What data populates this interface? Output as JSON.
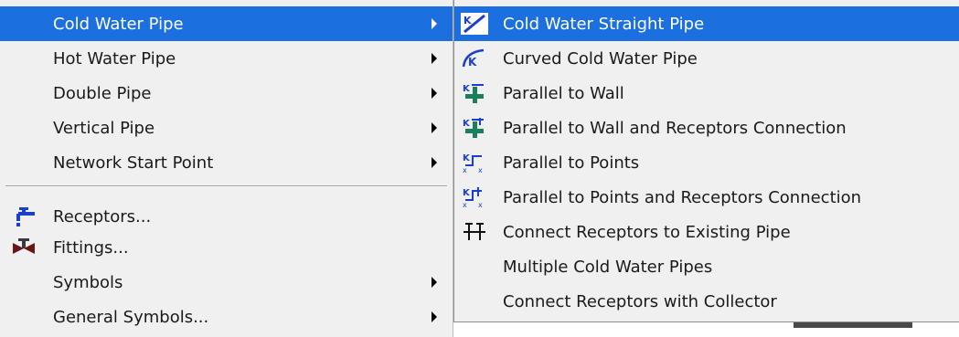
{
  "main_menu": {
    "items": [
      {
        "label": "Cold Water Pipe"
      },
      {
        "label": "Hot Water Pipe"
      },
      {
        "label": "Double Pipe"
      },
      {
        "label": "Vertical Pipe"
      },
      {
        "label": "Network Start Point"
      },
      {
        "label": "Receptors..."
      },
      {
        "label": "Fittings..."
      },
      {
        "label": "Symbols"
      },
      {
        "label": "General Symbols..."
      }
    ]
  },
  "submenu": {
    "items": [
      {
        "label": "Cold Water Straight Pipe"
      },
      {
        "label": "Curved Cold Water Pipe"
      },
      {
        "label": "Parallel to Wall"
      },
      {
        "label": "Parallel to Wall and Receptors Connection"
      },
      {
        "label": "Parallel to Points"
      },
      {
        "label": "Parallel to Points and Receptors Connection"
      },
      {
        "label": "Connect Receptors to Existing Pipe"
      },
      {
        "label": "Multiple Cold Water Pipes"
      },
      {
        "label": "Connect Receptors with Collector"
      }
    ]
  },
  "colors": {
    "highlight": "#1c6fde",
    "menu_bg": "#f0f0f0",
    "icon_blue": "#1a3fcf",
    "icon_green": "#1a7f5a"
  },
  "icons": {
    "receptors": "tap-icon",
    "fittings": "valve-icon",
    "straight_pipe": "straight-pipe-icon",
    "curved_pipe": "curved-pipe-icon",
    "parallel_wall": "parallel-wall-icon",
    "parallel_wall_receptors": "parallel-wall-receptors-icon",
    "parallel_points": "parallel-points-icon",
    "parallel_points_receptors": "parallel-points-receptors-icon",
    "connect_existing": "connect-existing-pipe-icon"
  }
}
